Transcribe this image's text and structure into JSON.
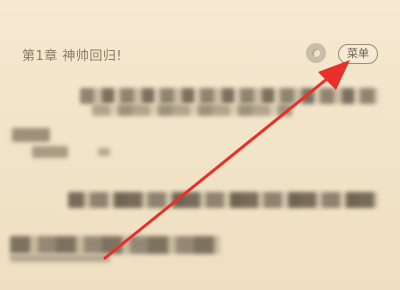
{
  "reader": {
    "chapter_title": "第1章 神帅回归!",
    "listen_icon": "audio-listen-icon",
    "menu_label": "菜单"
  },
  "annotation": {
    "arrow_color": "#e8302a"
  }
}
